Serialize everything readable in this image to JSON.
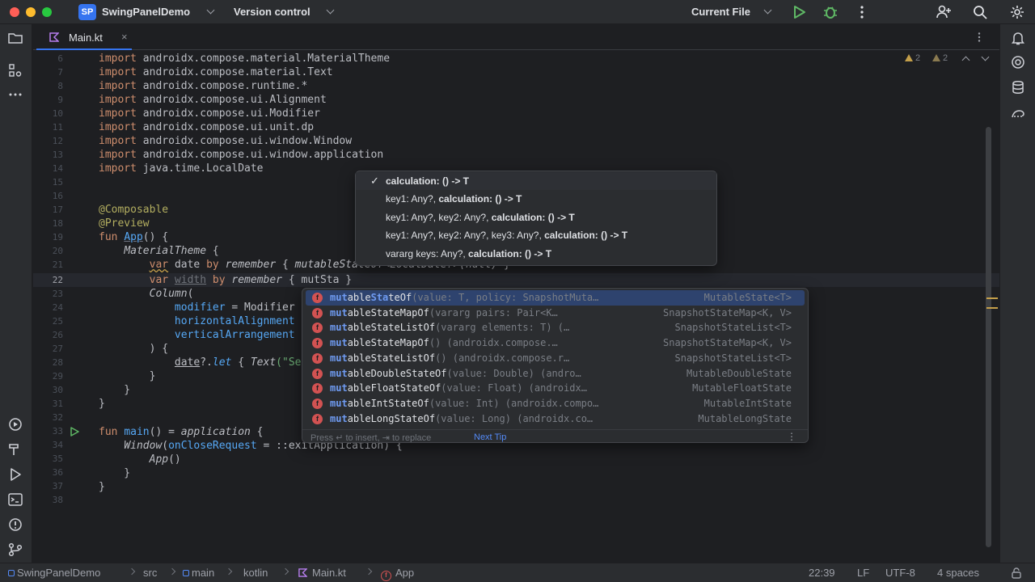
{
  "titlebar": {
    "project_badge": "SP",
    "project_name": "SwingPanelDemo",
    "vcs_label": "Version control",
    "run_config": "Current File"
  },
  "tab": {
    "label": "Main.kt",
    "close": "×"
  },
  "inspections": {
    "warnings_1": "2",
    "warnings_2": "2"
  },
  "gutter": {
    "line_numbers": [
      "6",
      "7",
      "8",
      "9",
      "10",
      "11",
      "12",
      "13",
      "14",
      "15",
      "16",
      "17",
      "18",
      "19",
      "20",
      "21",
      "22",
      "23",
      "24",
      "25",
      "26",
      "27",
      "28",
      "29",
      "30",
      "31",
      "32",
      "33",
      "34",
      "35",
      "36",
      "37",
      "38"
    ],
    "current_line": "22"
  },
  "code": {
    "l6": [
      "import",
      " androidx.compose.material.MaterialTheme"
    ],
    "l7": [
      "import",
      " androidx.compose.material.Text"
    ],
    "l8": [
      "import",
      " androidx.compose.runtime.*"
    ],
    "l9": [
      "import",
      " androidx.compose.ui.Alignment"
    ],
    "l10": [
      "import",
      " androidx.compose.ui.Modifier"
    ],
    "l11": [
      "import",
      " androidx.compose.ui.unit.dp"
    ],
    "l12": [
      "import",
      " androidx.compose.ui.window.Window"
    ],
    "l13": [
      "import",
      " androidx.compose.ui.window.application"
    ],
    "l14": [
      "import",
      " java.time.LocalDate"
    ],
    "l17": "@Composable",
    "l18": "@Preview",
    "l19": [
      "fun ",
      "App",
      "() {"
    ],
    "l20": [
      "    ",
      "MaterialTheme",
      " {"
    ],
    "l21": [
      "        ",
      "var",
      " ",
      "date",
      " ",
      "by",
      " ",
      "remember",
      " { ",
      "mutableStateOf<LocalDate?>(null)",
      " }"
    ],
    "l22": [
      "        ",
      "var",
      " ",
      "width",
      " ",
      "by",
      " ",
      "remember",
      " { mutSta }"
    ],
    "l23": [
      "        ",
      "Column",
      "("
    ],
    "l24": [
      "            ",
      "modifier",
      " = Modifier"
    ],
    "l25": [
      "            ",
      "horizontalAlignment"
    ],
    "l26": [
      "            ",
      "verticalArrangement"
    ],
    "l27": "        ) {",
    "l28": [
      "            ",
      "date",
      "?.",
      "let",
      " { ",
      "Text",
      "(\"Selected date: ${it.",
      "toString",
      "()}",
      "\"",
      ") }"
    ],
    "l29": "        }",
    "l30": "    }",
    "l31": "}",
    "l33": [
      "fun ",
      "main",
      "() = ",
      "application",
      " {"
    ],
    "l34": [
      "    ",
      "Window",
      "(",
      "onCloseRequest",
      " = ::exitApplication) {"
    ],
    "l35": [
      "        ",
      "App",
      "()"
    ],
    "l36": "    }",
    "l37": "}"
  },
  "param_info": {
    "rows": [
      {
        "plain": "",
        "bold": "calculation: () -> T"
      },
      {
        "plain": "key1: Any?, ",
        "bold": "calculation: () -> T"
      },
      {
        "plain": "key1: Any?, key2: Any?, ",
        "bold": "calculation: () -> T"
      },
      {
        "plain": "key1: Any?, key2: Any?, key3: Any?, ",
        "bold": "calculation: () -> T"
      },
      {
        "plain": "vararg keys: Any?, ",
        "bold": "calculation: () -> T"
      }
    ],
    "check": "✓"
  },
  "completion": {
    "items": [
      {
        "icon": "f",
        "p1": "mut",
        "b1": "able",
        "p2": "Sta",
        "b2": "teOf",
        "sig": "(value: T, policy: SnapshotMuta…",
        "type": "MutableState<T>"
      },
      {
        "icon": "f",
        "p1": "mut",
        "b1": "ableSta",
        "p2": "",
        "b2": "teMapOf",
        "sig": "(vararg pairs: Pair<K…",
        "type": "SnapshotStateMap<K, V>"
      },
      {
        "icon": "f",
        "p1": "mut",
        "b1": "ableSta",
        "p2": "",
        "b2": "teListOf",
        "sig": "(vararg elements: T) (…",
        "type": "SnapshotStateList<T>"
      },
      {
        "icon": "f",
        "p1": "mut",
        "b1": "ableSta",
        "p2": "",
        "b2": "teMapOf",
        "sig": "() (androidx.compose.…",
        "type": "SnapshotStateMap<K, V>"
      },
      {
        "icon": "f",
        "p1": "mut",
        "b1": "ableSta",
        "p2": "",
        "b2": "teListOf",
        "sig": "() (androidx.compose.r…",
        "type": "SnapshotStateList<T>"
      },
      {
        "icon": "f",
        "p1": "mut",
        "b1": "ableDoubleSta",
        "p2": "",
        "b2": "teOf",
        "sig": "(value: Double) (andro…",
        "type": "MutableDoubleState"
      },
      {
        "icon": "f",
        "p1": "mut",
        "b1": "ableFloatSta",
        "p2": "",
        "b2": "teOf",
        "sig": "(value: Float) (androidx…",
        "type": "MutableFloatState"
      },
      {
        "icon": "f",
        "p1": "mut",
        "b1": "ableIntSta",
        "p2": "",
        "b2": "teOf",
        "sig": "(value: Int) (androidx.compo…",
        "type": "MutableIntState"
      },
      {
        "icon": "f",
        "p1": "mut",
        "b1": "ableLongSta",
        "p2": "",
        "b2": "teOf",
        "sig": "(value: Long) (androidx.co…",
        "type": "MutableLongState"
      }
    ],
    "hint": "Press ↵ to insert, ⇥ to replace",
    "next_tip": "Next Tip",
    "more": "⋮"
  },
  "statusbar": {
    "crumbs": [
      "SwingPanelDemo",
      "src",
      "main",
      "kotlin",
      "Main.kt",
      "App"
    ],
    "position": "22:39",
    "line_sep": "LF",
    "encoding": "UTF-8",
    "indent": "4 spaces"
  },
  "colors": {
    "accent": "#3574f0",
    "error": "#d25252",
    "warning": "#c49f4a"
  }
}
